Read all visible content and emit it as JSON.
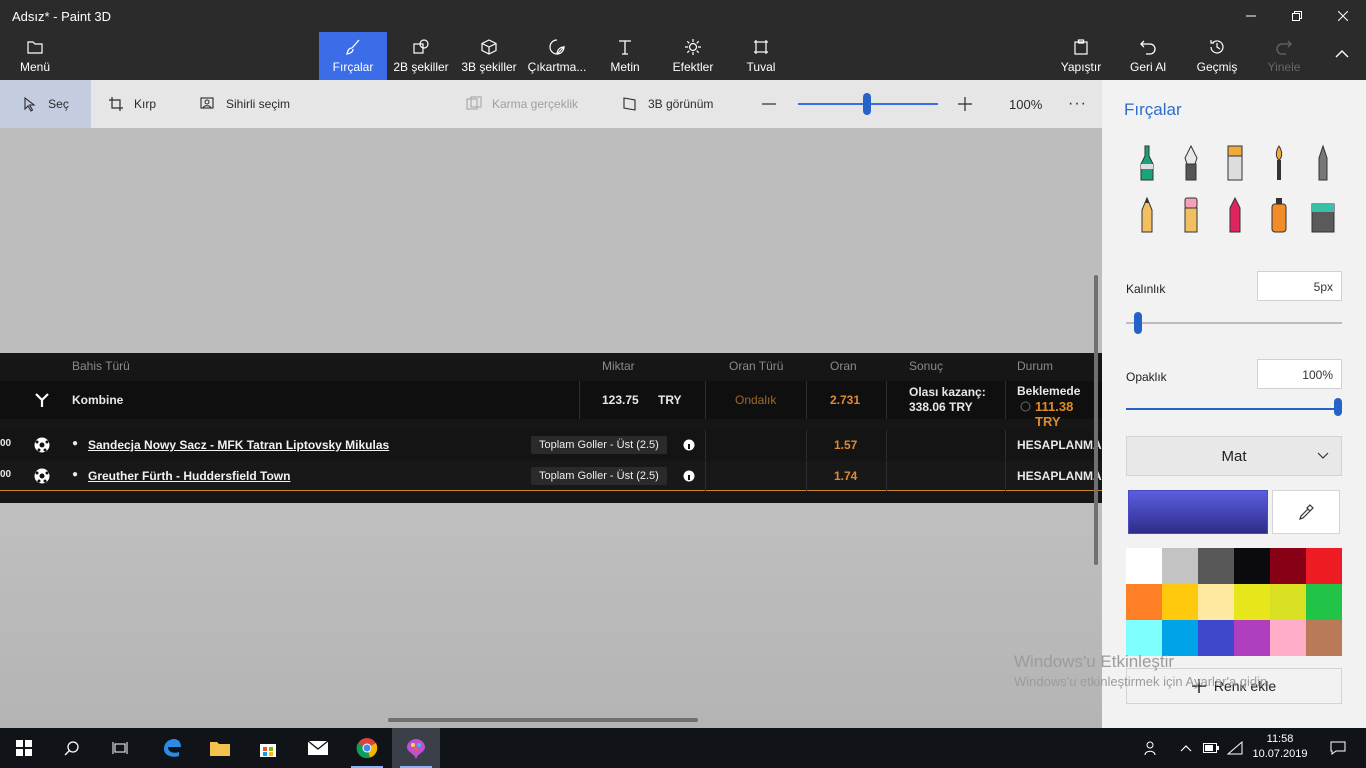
{
  "window": {
    "title": "Adsız* - Paint 3D"
  },
  "toolbar": {
    "menu": "Menü",
    "brushes": "Fırçalar",
    "shapes2d": "2B şekiller",
    "shapes3d": "3B şekiller",
    "stickers": "Çıkartma...",
    "text": "Metin",
    "effects": "Efektler",
    "canvas": "Tuval",
    "paste": "Yapıştır",
    "undo": "Geri Al",
    "history": "Geçmiş",
    "redo": "Yinele"
  },
  "subbar": {
    "select": "Seç",
    "crop": "Kırp",
    "magic_select": "Sihirli seçim",
    "mixed_reality": "Karma gerçeklik",
    "view3d": "3B görünüm",
    "zoom": "100%",
    "zoom_level": 0.5
  },
  "betslip": {
    "headers": {
      "bet_type": "Bahis Türü",
      "amount": "Miktar",
      "odds_type": "Oran Türü",
      "odds": "Oran",
      "result": "Sonuç",
      "status": "Durum"
    },
    "main": {
      "type": "Kombine",
      "amount": "123.75",
      "currency": "TRY",
      "odds_type": "Ondalık",
      "odds": "2.731",
      "win_label": "Olası kazanç:",
      "win_value": "338.06 TRY",
      "status": "Beklemede",
      "status_value": "111.38 TRY"
    },
    "matches": [
      {
        "prefix": "00",
        "name": "Sandecja Nowy Sacz - MFK Tatran Liptovsky Mikulas",
        "market": "Toplam Goller - Üst (2.5)",
        "odds": "1.57",
        "status": "HESAPLANMAD"
      },
      {
        "prefix": "00",
        "name": "Greuther Fürth - Huddersfield Town",
        "market": "Toplam Goller - Üst (2.5)",
        "odds": "1.74",
        "status": "HESAPLANMAD"
      }
    ]
  },
  "panel": {
    "title": "Fırçalar",
    "thickness_label": "Kalınlık",
    "thickness_value": "5px",
    "thickness_level": 0.03,
    "opacity_label": "Opaklık",
    "opacity_value": "100%",
    "opacity_level": 1.0,
    "finish": "Mat",
    "add_color": "Renk ekle",
    "current_color": "#4a4bc4",
    "palette": [
      "#ffffff",
      "#c3c3c3",
      "#585858",
      "#0a0a0f",
      "#880015",
      "#ed1c24",
      "#ff7f27",
      "#ffc90e",
      "#fde9a0",
      "#e6e61a",
      "#d9e021",
      "#22c447",
      "#80ffff",
      "#00a2e8",
      "#3f48cc",
      "#b03fc0",
      "#ffaec9",
      "#b97a57"
    ]
  },
  "watermark": {
    "line1": "Windows'u Etkinleştir",
    "line2": "Windows'u etkinleştirmek için Ayarlar'a gidin."
  },
  "taskbar": {
    "time": "11:58",
    "date": "10.07.2019"
  }
}
